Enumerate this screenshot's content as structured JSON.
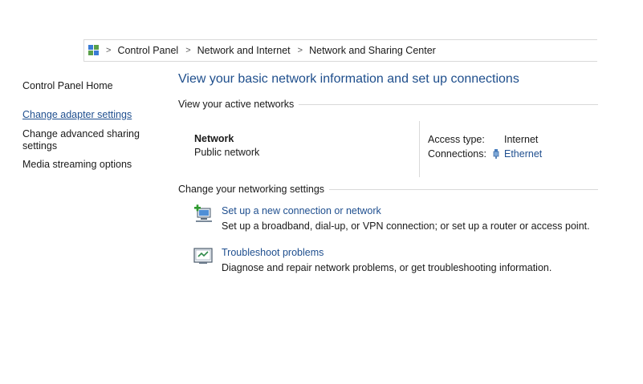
{
  "breadcrumb": {
    "items": [
      "Control Panel",
      "Network and Internet",
      "Network and Sharing Center"
    ],
    "separator": ">",
    "icon": "control-panel-icon"
  },
  "sidebar": {
    "items": [
      {
        "label": "Control Panel Home"
      },
      {
        "label": "Change adapter settings"
      },
      {
        "label": "Change advanced sharing settings"
      },
      {
        "label": "Media streaming options"
      }
    ]
  },
  "main": {
    "title": "View your basic network information and set up connections",
    "active_networks": {
      "header": "View your active networks",
      "name": "Network",
      "category": "Public network",
      "access_type_label": "Access type:",
      "access_type_value": "Internet",
      "connections_label": "Connections:",
      "connections_value": "Ethernet",
      "connection_icon": "ethernet-icon"
    },
    "settings": {
      "header": "Change your networking settings",
      "tasks": [
        {
          "icon": "new-connection-icon",
          "label": "Set up a new connection or network",
          "description": "Set up a broadband, dial-up, or VPN connection; or set up a router or access point."
        },
        {
          "icon": "troubleshoot-icon",
          "label": "Troubleshoot problems",
          "description": "Diagnose and repair network problems, or get troubleshooting information."
        }
      ]
    }
  },
  "colors": {
    "link": "#1f4f8f",
    "title": "#1e4e8c",
    "divider": "#d9d9d9"
  }
}
